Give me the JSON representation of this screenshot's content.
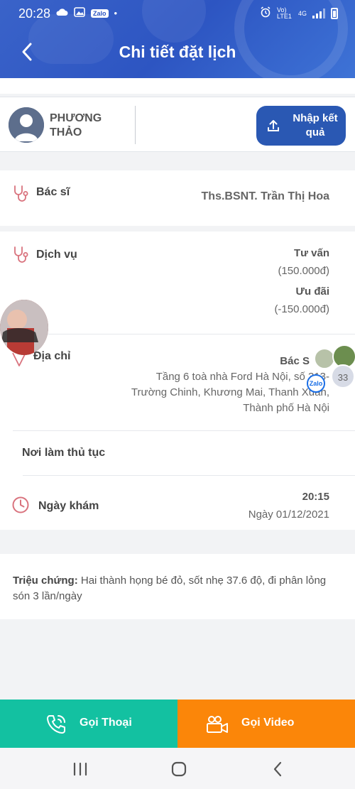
{
  "status_bar": {
    "time": "20:28",
    "network_label": "Vo) LTE1",
    "network_type": "4G",
    "zalo_badge": "Zalo"
  },
  "header": {
    "title": "Chi tiết đặt lịch"
  },
  "patient": {
    "name": "PHƯƠNG THẢO",
    "upload_button_label": "Nhập kết quả"
  },
  "doctor": {
    "label": "Bác sĩ",
    "value": "Ths.BSNT. Trần Thị Hoa"
  },
  "service": {
    "label": "Dịch vụ",
    "items": [
      {
        "name": "Tư vấn",
        "price": "(150.000đ)"
      },
      {
        "name": "Ưu đãi",
        "price": "(-150.000đ)"
      }
    ]
  },
  "address": {
    "label": "Địa chỉ",
    "place_partial": "Bác S",
    "line1": "Tầng 6 toà nhà Ford Hà Nội, số 313-",
    "line2": "Trường Chinh, Khương Mai, Thanh Xuân,",
    "line3": "Thành phố Hà Nội"
  },
  "procedure": {
    "label": "Nơi làm thủ tục"
  },
  "appointment": {
    "label": "Ngày khám",
    "time": "20:15",
    "date": "Ngày 01/12/2021"
  },
  "symptom": {
    "label": "Triệu chứng:",
    "text": "Hai thành họng bé đỏ, sốt nhẹ 37.6 độ, đi phân lỏng són 3 lần/ngày"
  },
  "chat_bubble": {
    "count": "33",
    "badge": "Zalo"
  },
  "actions": {
    "call_label": "Gọi Thoại",
    "video_label": "Gọi Video"
  },
  "colors": {
    "header": "#2d55c2",
    "upload_button": "#2a58b3",
    "call": "#13c1a1",
    "video": "#fb8609",
    "icon_red": "#d9737e"
  }
}
